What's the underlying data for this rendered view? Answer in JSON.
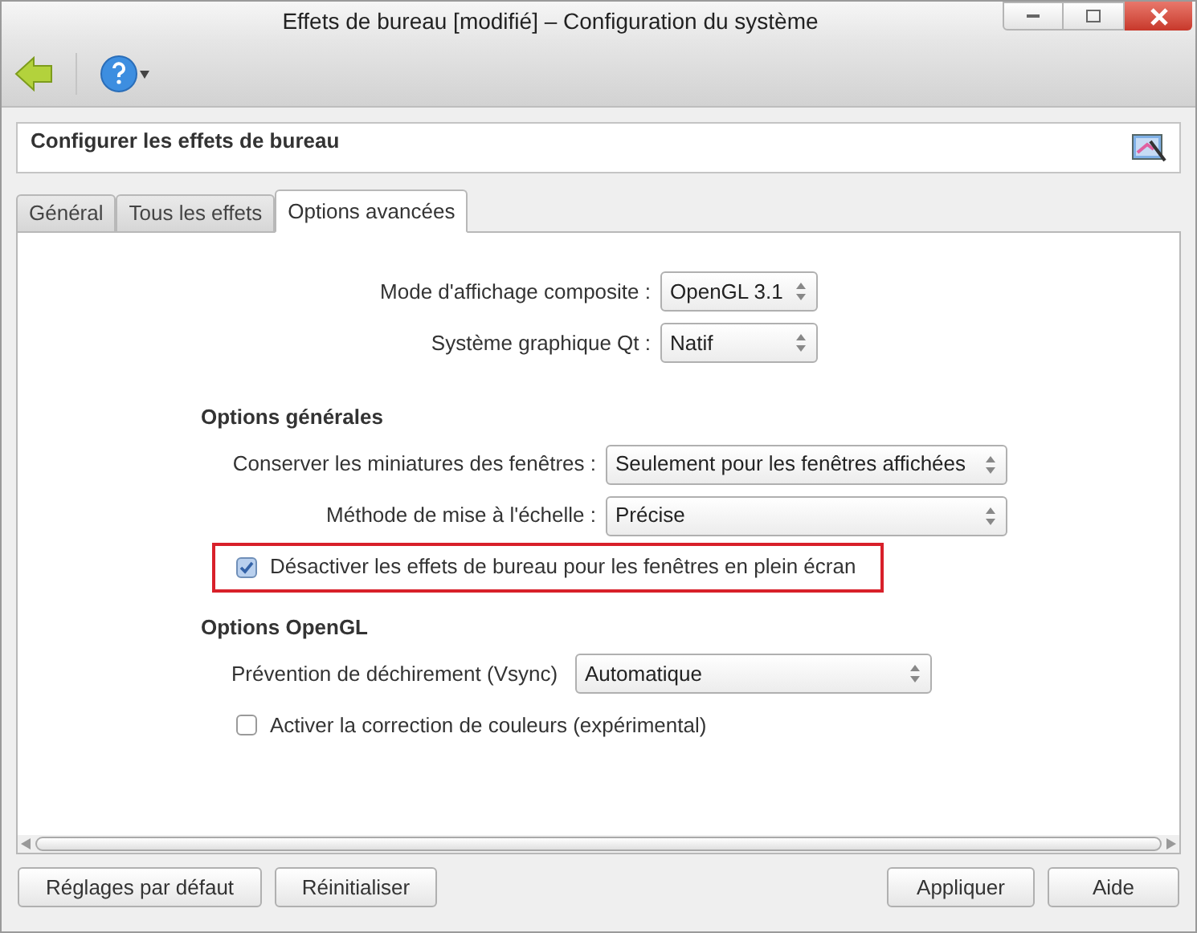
{
  "window": {
    "title": "Effets de bureau [modifié] – Configuration du système"
  },
  "header": {
    "title": "Configurer les effets de bureau"
  },
  "tabs": [
    {
      "label": "Général",
      "selected": false
    },
    {
      "label": "Tous les effets",
      "selected": false
    },
    {
      "label": "Options avancées",
      "selected": true
    }
  ],
  "top_fields": [
    {
      "label": "Mode d'affichage composite :",
      "value": "OpenGL 3.1"
    },
    {
      "label": "Système graphique Qt :",
      "value": "Natif"
    }
  ],
  "sections": [
    {
      "title": "Options générales",
      "items": [
        {
          "kind": "combo",
          "label": "Conserver les miniatures des fenêtres :",
          "value": "Seulement pour les fenêtres affichées"
        },
        {
          "kind": "combo",
          "label": "Méthode de mise à l'échelle :",
          "value": "Précise"
        },
        {
          "kind": "checkbox",
          "label": "Désactiver les effets de bureau pour les fenêtres en plein écran",
          "checked": true,
          "highlighted": true
        }
      ]
    },
    {
      "title": "Options OpenGL",
      "items": [
        {
          "kind": "combo",
          "label": "Prévention de déchirement (Vsync)",
          "value": "Automatique"
        },
        {
          "kind": "checkbox",
          "label": "Activer la correction de couleurs (expérimental)",
          "checked": false,
          "highlighted": false
        }
      ]
    }
  ],
  "buttons_left": [
    "Réglages par défaut",
    "Réinitialiser"
  ],
  "buttons_right": [
    "Appliquer",
    "Aide"
  ]
}
